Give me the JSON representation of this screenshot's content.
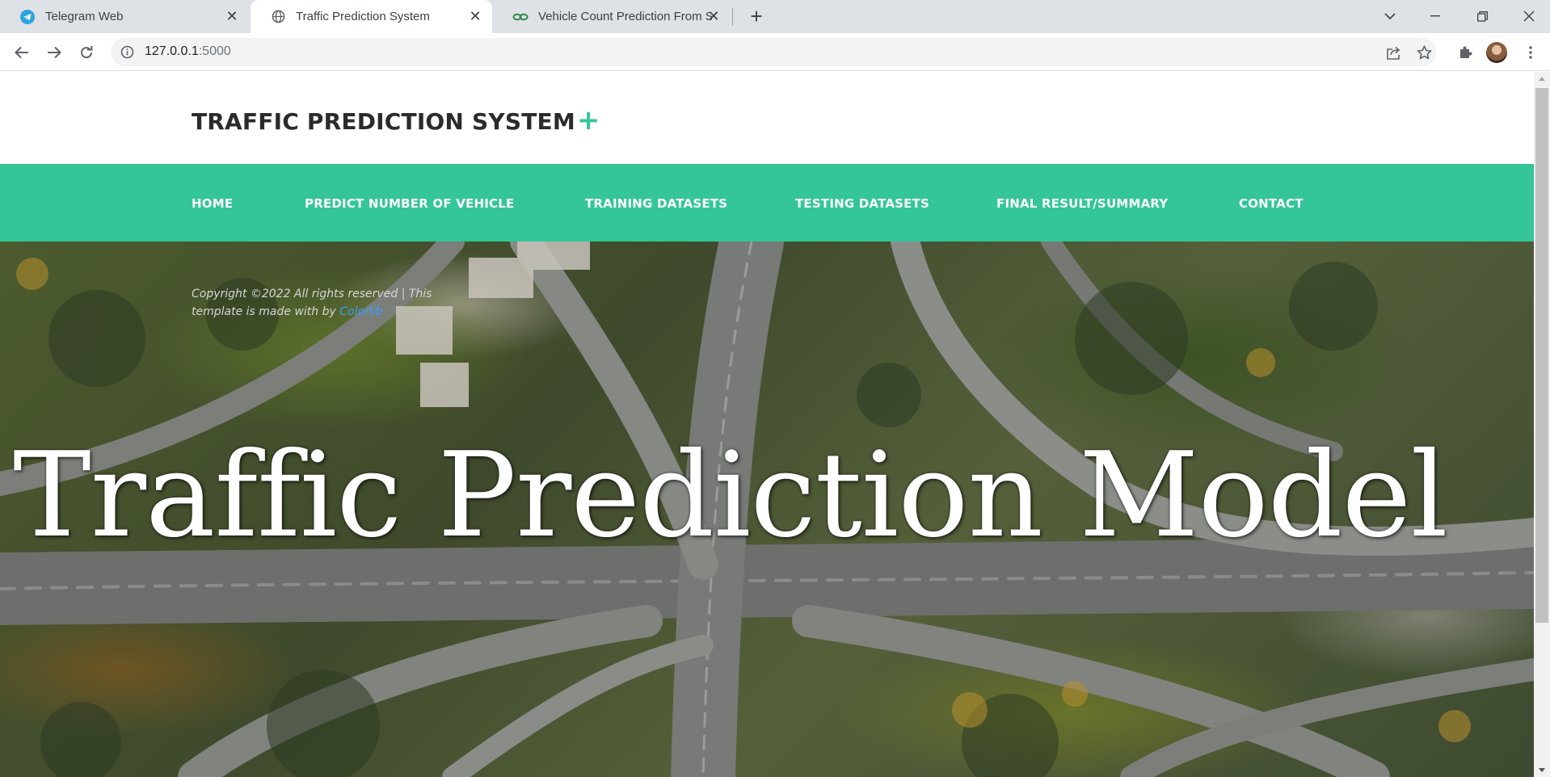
{
  "browser": {
    "tabs": [
      {
        "title": "Telegram Web",
        "icon": "telegram-icon",
        "active": false
      },
      {
        "title": "Traffic Prediction System",
        "icon": "globe-icon",
        "active": true
      },
      {
        "title": "Vehicle Count Prediction From Se",
        "icon": "link-icon",
        "active": false
      }
    ],
    "url_host": "127.0.0.1",
    "url_port": ":5000"
  },
  "site": {
    "logo_text": "TRAFFIC PREDICTION SYSTEM",
    "logo_plus": "+",
    "accent_color": "#34c598",
    "menu": [
      {
        "label": "HOME"
      },
      {
        "label": "PREDICT NUMBER OF VEHICLE"
      },
      {
        "label": "TRAINING DATASETS"
      },
      {
        "label": "TESTING DATASETS"
      },
      {
        "label": "FINAL RESULT/SUMMARY"
      },
      {
        "label": "CONTACT"
      }
    ],
    "copyright_text": "Copyright ©2022 All rights reserved | This template is made with by ",
    "copyright_link": "Colorlib",
    "hero_title": "Traffic Prediction Model"
  }
}
